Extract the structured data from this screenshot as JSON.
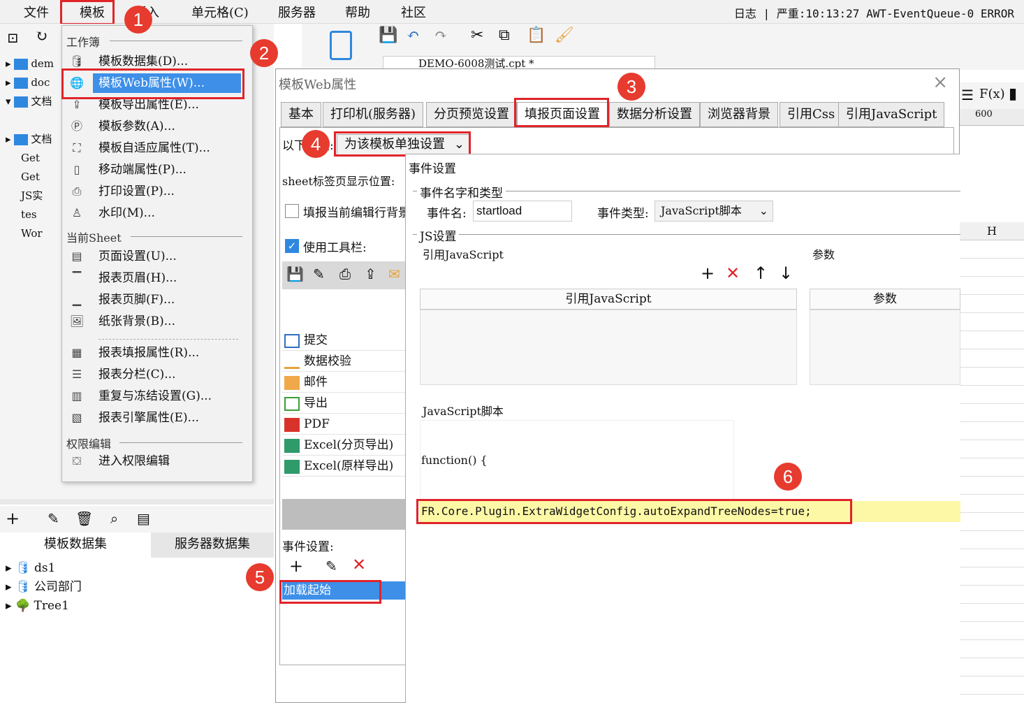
{
  "menubar": {
    "items": [
      "文件",
      "模板",
      "插入",
      "单元格(C)",
      "服务器",
      "帮助",
      "社区"
    ],
    "log": "日志 | 严重:10:13:27 AWT-EventQueue-0 ERROR"
  },
  "badges": [
    "1",
    "2",
    "3",
    "4",
    "5",
    "6"
  ],
  "dropdown": {
    "sec_workbook": "工作簿",
    "items_workbook": [
      "模板数据集(D)...",
      "模板Web属性(W)...",
      "模板导出属性(E)...",
      "模板参数(A)...",
      "模板自适应属性(T)...",
      "移动端属性(P)...",
      "打印设置(P)...",
      "水印(M)..."
    ],
    "sec_sheet": "当前Sheet",
    "items_sheet": [
      "页面设置(U)...",
      "报表页眉(H)...",
      "报表页脚(F)...",
      "纸张背景(B)..."
    ],
    "items_sheet2": [
      "报表填报属性(R)...",
      "报表分栏(C)...",
      "重复与冻结设置(G)...",
      "报表引擎属性(E)..."
    ],
    "sec_perm": "权限编辑",
    "items_perm": [
      "进入权限编辑"
    ]
  },
  "tree": {
    "items": [
      "dem",
      "doc",
      "文档",
      "文档",
      "Get",
      "Get",
      "JS实",
      "tes",
      "Wor"
    ]
  },
  "bottom_panel": {
    "tab1": "模板数据集",
    "tab2": "服务器数据集",
    "items": [
      "ds1",
      "公司部门",
      "Tree1"
    ]
  },
  "editor_tab": "DEMO-6008测试.cpt *",
  "ruler": {
    "mark": "600",
    "col": "H"
  },
  "dialog": {
    "title": "模板Web属性",
    "tabs": [
      "基本",
      "打印机(服务器)",
      "分页预览设置",
      "填报页面设置",
      "数据分析设置",
      "浏览器背景",
      "引用Css",
      "引用JavaScript"
    ],
    "setting_label": "以下设置:",
    "setting_select": "为该模板单独设置",
    "sheet_label": "sheet标签页显示位置:",
    "checkbox1": "填报当前编辑行背景",
    "checkbox2": "使用工具栏:",
    "toolbar_items": [
      "提交",
      "数据校验",
      "邮件",
      "导出",
      "PDF",
      "Excel(分页导出)",
      "Excel(原样导出)"
    ],
    "event_label": "事件设置:",
    "event_item": "加载起始"
  },
  "event_dialog": {
    "title": "事件设置",
    "grp_name": "事件名字和类型",
    "name_label": "事件名:",
    "name_value": "startload",
    "type_label": "事件类型:",
    "type_value": "JavaScript脚本",
    "grp_js": "JS设置",
    "ref_js_label": "引用JavaScript",
    "param_label": "参数",
    "col_ref_js": "引用JavaScript",
    "col_param": "参数",
    "script_label": "JavaScript脚本",
    "code_line1": "function() {",
    "code_line2": "FR.Core.Plugin.ExtraWidgetConfig.autoExpandTreeNodes=true;"
  }
}
